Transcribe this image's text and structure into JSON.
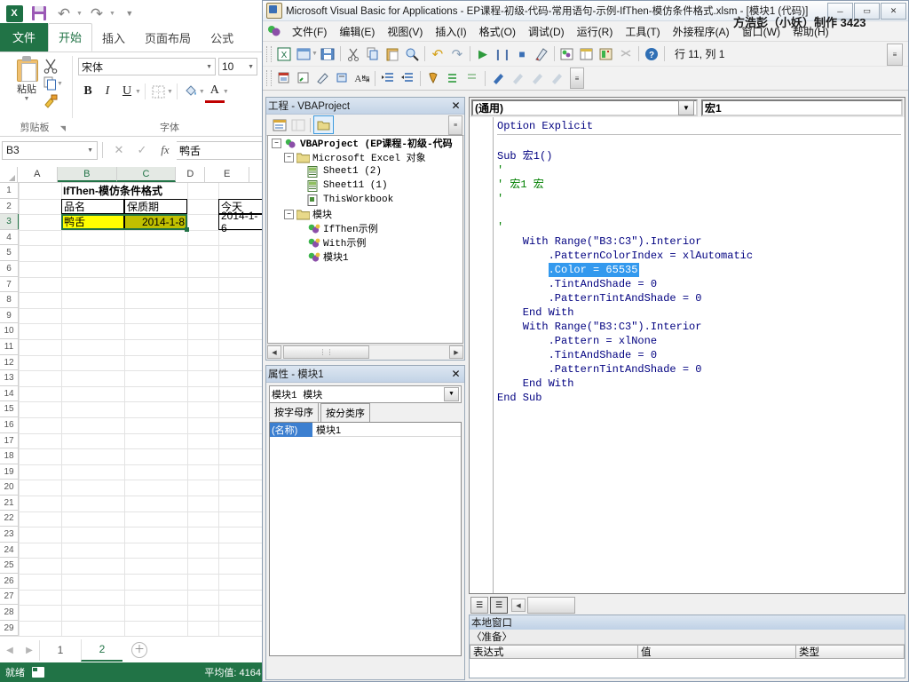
{
  "excel": {
    "qat": {
      "logo": "X",
      "save": "save-icon",
      "undo": "undo-icon",
      "redo": "redo-icon",
      "more": "more-icon"
    },
    "ribbon_tabs": [
      {
        "label": "文件",
        "active": false,
        "file": true
      },
      {
        "label": "开始",
        "active": true,
        "file": false
      },
      {
        "label": "插入",
        "active": false,
        "file": false
      },
      {
        "label": "页面布局",
        "active": false,
        "file": false
      },
      {
        "label": "公式",
        "active": false,
        "file": false
      }
    ],
    "clipboard_group": {
      "paste_label": "粘贴",
      "group_label": "剪贴板",
      "cut_icon": "scissors-icon",
      "copy_icon": "copy-icon",
      "format_painter_icon": "format-painter-icon"
    },
    "font_group": {
      "group_label": "字体",
      "font_name": "宋体",
      "font_size": "10",
      "bold": "B",
      "italic": "I",
      "underline": "U",
      "borders_icon": "borders-icon",
      "fill_icon": "fill-color-icon",
      "font_color": "A"
    },
    "namebox": {
      "value": "B3"
    },
    "formula_buttons": {
      "cancel": "✕",
      "enter": "✓",
      "fx": "fx"
    },
    "formula_value": "鸭舌",
    "columns": [
      "A",
      "B",
      "C",
      "D",
      "E"
    ],
    "selected_columns": [
      "B",
      "C"
    ],
    "rows": [
      1,
      2,
      3,
      4,
      5,
      6,
      7,
      8,
      9,
      10,
      11,
      12,
      13,
      14,
      15,
      16,
      17,
      18,
      19,
      20,
      21,
      22,
      23,
      24,
      25,
      26,
      27,
      28,
      29
    ],
    "selected_row": 3,
    "cells": [
      {
        "ref": "B1",
        "text": "IfThen-模仿条件格式",
        "bold": true,
        "bg": "",
        "align": "left"
      },
      {
        "ref": "B2",
        "text": "品名",
        "bold": false,
        "bg": "#ffffff",
        "align": "left"
      },
      {
        "ref": "C2",
        "text": "保质期",
        "bold": false,
        "bg": "#ffffff",
        "align": "left"
      },
      {
        "ref": "B3",
        "text": "鸭舌",
        "bold": false,
        "bg": "#ffff00",
        "align": "left"
      },
      {
        "ref": "C3",
        "text": "2014-1-8",
        "bold": false,
        "bg": "#c0c000",
        "align": "right"
      },
      {
        "ref": "E2",
        "text": "今天",
        "bold": false,
        "bg": "#ffffff",
        "align": "left"
      },
      {
        "ref": "E3",
        "text": "2014-1-6",
        "bold": false,
        "bg": "#ffffff",
        "align": "right"
      }
    ],
    "sheet_tabs": [
      {
        "label": "1",
        "active": false
      },
      {
        "label": "2",
        "active": true
      }
    ],
    "add_sheet": "＋",
    "nav_prev": "◀",
    "nav_next": "▶",
    "status": {
      "ready": "就绪",
      "macro_icon": "record-macro-icon",
      "average": "平均值: 4164"
    }
  },
  "vba": {
    "title": "Microsoft Visual Basic for Applications - EP课程-初级-代码-常用语句-示例-IfThen-模仿条件格式.xlsm - [模块1 (代码)]",
    "watermark": "方浩彭（小妖）制作 3423",
    "window_buttons": [
      "─",
      "▭",
      "✕"
    ],
    "menu": [
      "文件(F)",
      "编辑(E)",
      "视图(V)",
      "插入(I)",
      "格式(O)",
      "调试(D)",
      "运行(R)",
      "工具(T)",
      "外接程序(A)",
      "窗口(W)",
      "帮助(H)"
    ],
    "toolbar_row1": [
      "excel-view-icon",
      "userform-icon",
      "save-icon",
      "cut-icon",
      "copy-icon",
      "paste-icon",
      "find-icon",
      "undo-icon",
      "redo-icon",
      "run-icon",
      "break-icon",
      "reset-icon",
      "design-mode-icon",
      "project-explorer-icon",
      "properties-window-icon",
      "object-browser-icon",
      "toolbox-icon",
      "help-icon"
    ],
    "toolbar_row2": [
      "list-properties-icon",
      "list-constants-icon",
      "quick-info-icon",
      "parameter-info-icon",
      "complete-word-icon",
      "indent-icon",
      "outdent-icon",
      "toggle-breakpoint-icon",
      "comment-block-icon",
      "uncomment-block-icon",
      "bookmark-toggle-icon",
      "bookmark-next-icon",
      "bookmark-prev-icon",
      "bookmark-clear-icon"
    ],
    "position": "行 11, 列 1",
    "project": {
      "title": "工程 - VBAProject",
      "close": "✕",
      "toolbar": [
        "view-code-icon",
        "view-object-icon",
        "toggle-folders-icon"
      ],
      "tree": [
        {
          "depth": 0,
          "expander": "−",
          "icon": "project-icon",
          "label": "VBAProject (EP课程-初级-代码"
        },
        {
          "depth": 1,
          "expander": "−",
          "icon": "folder-icon",
          "label": "Microsoft Excel 对象"
        },
        {
          "depth": 2,
          "expander": "",
          "icon": "sheet-icon",
          "label": "Sheet1 (2)"
        },
        {
          "depth": 2,
          "expander": "",
          "icon": "sheet-icon",
          "label": "Sheet11 (1)"
        },
        {
          "depth": 2,
          "expander": "",
          "icon": "workbook-icon",
          "label": "ThisWorkbook"
        },
        {
          "depth": 1,
          "expander": "−",
          "icon": "folder-icon",
          "label": "模块"
        },
        {
          "depth": 2,
          "expander": "",
          "icon": "module-icon",
          "label": "IfThen示例"
        },
        {
          "depth": 2,
          "expander": "",
          "icon": "module-icon",
          "label": "With示例"
        },
        {
          "depth": 2,
          "expander": "",
          "icon": "module-icon",
          "label": "模块1"
        }
      ]
    },
    "properties": {
      "title": "属性 - 模块1",
      "close": "✕",
      "combo": "模块1 模块",
      "tabs": [
        {
          "label": "按字母序",
          "active": true
        },
        {
          "label": "按分类序",
          "active": false
        }
      ],
      "rows": [
        {
          "name": "(名称)",
          "value": "模块1"
        }
      ]
    },
    "code": {
      "object_combo": "(通用)",
      "proc_combo": "宏1",
      "lines": [
        {
          "text": "Option Explicit",
          "kind": "kw",
          "selected": false
        },
        {
          "text": "",
          "kind": "plain",
          "selected": false
        },
        {
          "text": "Sub 宏1()",
          "kind": "kw",
          "selected": false
        },
        {
          "text": "'",
          "kind": "cmt",
          "selected": false
        },
        {
          "text": "' 宏1 宏",
          "kind": "cmt",
          "selected": false
        },
        {
          "text": "'",
          "kind": "cmt",
          "selected": false
        },
        {
          "text": "",
          "kind": "plain",
          "selected": false
        },
        {
          "text": "'",
          "kind": "cmt",
          "selected": false
        },
        {
          "text": "    With Range(\"B3:C3\").Interior",
          "kind": "kw",
          "selected": false
        },
        {
          "text": "        .PatternColorIndex = xlAutomatic",
          "kind": "kw",
          "selected": false
        },
        {
          "text": "        .Color = 65535",
          "kind": "kw",
          "selected": true
        },
        {
          "text": "        .TintAndShade = 0",
          "kind": "kw",
          "selected": false
        },
        {
          "text": "        .PatternTintAndShade = 0",
          "kind": "kw",
          "selected": false
        },
        {
          "text": "    End With",
          "kind": "kw",
          "selected": false
        },
        {
          "text": "    With Range(\"B3:C3\").Interior",
          "kind": "kw",
          "selected": false
        },
        {
          "text": "        .Pattern = xlNone",
          "kind": "kw",
          "selected": false
        },
        {
          "text": "        .TintAndShade = 0",
          "kind": "kw",
          "selected": false
        },
        {
          "text": "        .PatternTintAndShade = 0",
          "kind": "kw",
          "selected": false
        },
        {
          "text": "    End With",
          "kind": "kw",
          "selected": false
        },
        {
          "text": "End Sub",
          "kind": "kw",
          "selected": false
        }
      ],
      "view_buttons": [
        "procedure-view-icon",
        "full-module-view-icon"
      ],
      "hscroll_left": "◀"
    },
    "locals": {
      "title": "本地窗口",
      "context": "〈准备〉",
      "columns": [
        "表达式",
        "值",
        "类型"
      ]
    }
  },
  "colors": {
    "excel_green": "#217346",
    "highlight_blue": "#3399ee",
    "cell_yellow": "#ffff00",
    "cell_olive": "#c0c000",
    "comment_green": "#008000",
    "keyword_blue": "#000080"
  }
}
